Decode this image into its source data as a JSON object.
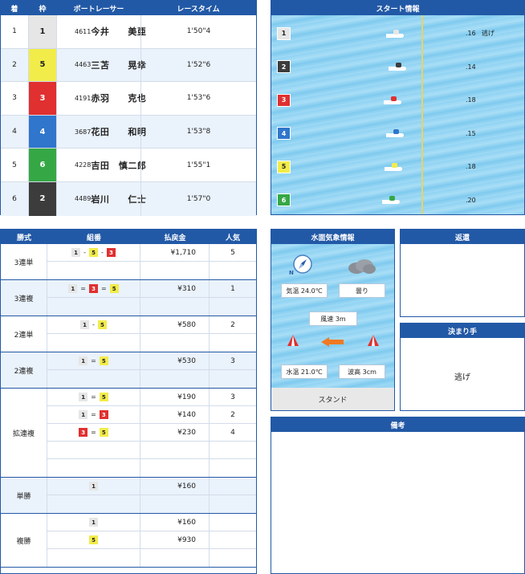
{
  "colors": {
    "frame1": "#e6e6e6",
    "frame2": "#3c3c3c",
    "frame3": "#e03030",
    "frame4": "#2f76cc",
    "frame5": "#f2ec4a",
    "frame6": "#35a845"
  },
  "results": {
    "headers": [
      "着",
      "枠",
      "ボートレーサー",
      "レースタイム"
    ],
    "rows": [
      {
        "rank": "1",
        "frame": "1",
        "num": "4611",
        "name": "今井　　美亜",
        "time": "1'50\"4"
      },
      {
        "rank": "2",
        "frame": "5",
        "num": "4463",
        "name": "三苫　　晃幸",
        "time": "1'52\"6"
      },
      {
        "rank": "3",
        "frame": "3",
        "num": "4191",
        "name": "赤羽　　克也",
        "time": "1'53\"6"
      },
      {
        "rank": "4",
        "frame": "4",
        "num": "3687",
        "name": "花田　　和明",
        "time": "1'53\"8"
      },
      {
        "rank": "5",
        "frame": "6",
        "num": "4228",
        "name": "吉田　慎二郎",
        "time": "1'55\"1"
      },
      {
        "rank": "6",
        "frame": "2",
        "num": "4489",
        "name": "岩川　　仁士",
        "time": "1'57\"0"
      }
    ]
  },
  "start": {
    "title": "スタート情報",
    "rows": [
      {
        "course": "1",
        "time": ".16",
        "kimarite": "逃げ"
      },
      {
        "course": "2",
        "time": ".14",
        "kimarite": ""
      },
      {
        "course": "3",
        "time": ".18",
        "kimarite": ""
      },
      {
        "course": "4",
        "time": ".15",
        "kimarite": ""
      },
      {
        "course": "5",
        "time": ".18",
        "kimarite": ""
      },
      {
        "course": "6",
        "time": ".20",
        "kimarite": ""
      }
    ]
  },
  "payout": {
    "headers": [
      "勝式",
      "組番",
      "払戻金",
      "人気"
    ],
    "groups": [
      {
        "kind": "3連単",
        "lines": [
          {
            "combo": [
              "1",
              "-",
              "5",
              "-",
              "3"
            ],
            "amount": "¥1,710",
            "pop": "5"
          },
          {
            "combo": [],
            "amount": "",
            "pop": ""
          }
        ]
      },
      {
        "kind": "3連複",
        "lines": [
          {
            "combo": [
              "1",
              "=",
              "3",
              "=",
              "5"
            ],
            "amount": "¥310",
            "pop": "1"
          },
          {
            "combo": [],
            "amount": "",
            "pop": ""
          }
        ]
      },
      {
        "kind": "2連単",
        "lines": [
          {
            "combo": [
              "1",
              "-",
              "5"
            ],
            "amount": "¥580",
            "pop": "2"
          },
          {
            "combo": [],
            "amount": "",
            "pop": ""
          }
        ]
      },
      {
        "kind": "2連複",
        "lines": [
          {
            "combo": [
              "1",
              "=",
              "5"
            ],
            "amount": "¥530",
            "pop": "3"
          },
          {
            "combo": [],
            "amount": "",
            "pop": ""
          }
        ]
      },
      {
        "kind": "拡連複",
        "lines": [
          {
            "combo": [
              "1",
              "=",
              "5"
            ],
            "amount": "¥190",
            "pop": "3"
          },
          {
            "combo": [
              "1",
              "=",
              "3"
            ],
            "amount": "¥140",
            "pop": "2"
          },
          {
            "combo": [
              "3",
              "=",
              "5"
            ],
            "amount": "¥230",
            "pop": "4"
          },
          {
            "combo": [],
            "amount": "",
            "pop": ""
          },
          {
            "combo": [],
            "amount": "",
            "pop": ""
          }
        ]
      },
      {
        "kind": "単勝",
        "lines": [
          {
            "combo": [
              "1"
            ],
            "amount": "¥160",
            "pop": ""
          },
          {
            "combo": [],
            "amount": "",
            "pop": ""
          }
        ]
      },
      {
        "kind": "複勝",
        "lines": [
          {
            "combo": [
              "1"
            ],
            "amount": "¥160",
            "pop": ""
          },
          {
            "combo": [
              "5"
            ],
            "amount": "¥930",
            "pop": ""
          },
          {
            "combo": [],
            "amount": "",
            "pop": ""
          }
        ]
      }
    ]
  },
  "weather": {
    "title": "水面気象情報",
    "compass_label": "N",
    "temperature": "気温 24.0℃",
    "condition": "曇り",
    "wind": "風速 3m",
    "water_temp": "水温 21.0℃",
    "wave": "波高 3cm",
    "stand": "スタンド",
    "icons": {
      "compass": "compass-icon",
      "weather": "cloud-icon",
      "wind": "wind-arrow-icon",
      "buoy": "buoy-icon"
    }
  },
  "henkan": {
    "title": "返還"
  },
  "kimarite": {
    "title": "決まり手",
    "value": "逃げ"
  },
  "bikou": {
    "title": "備考"
  }
}
